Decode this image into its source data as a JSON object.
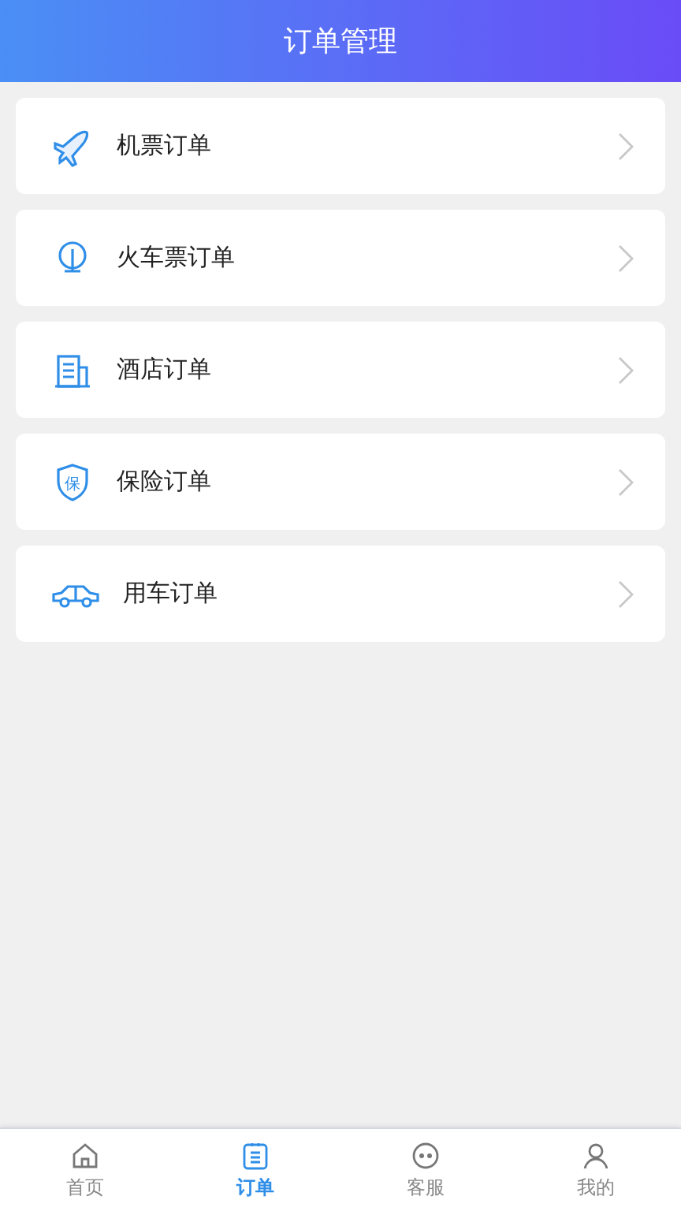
{
  "header": {
    "title": "订单管理"
  },
  "orders": [
    {
      "kind": "plane",
      "label": "机票订单"
    },
    {
      "kind": "train",
      "label": "火车票订单"
    },
    {
      "kind": "hotel",
      "label": "酒店订单"
    },
    {
      "kind": "insurance",
      "label": "保险订单",
      "icon_text": "保"
    },
    {
      "kind": "car",
      "label": "用车订单"
    }
  ],
  "tab_bar": [
    {
      "kind": "home",
      "label": "首页",
      "selected": false
    },
    {
      "kind": "orders",
      "label": "订单",
      "selected": true
    },
    {
      "kind": "service",
      "label": "客服",
      "selected": false
    },
    {
      "kind": "profile",
      "label": "我的",
      "selected": false
    }
  ]
}
